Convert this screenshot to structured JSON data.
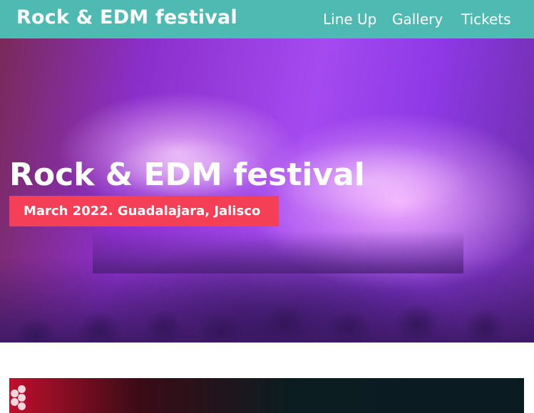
{
  "header": {
    "brand": "Rock & EDM festival",
    "nav": [
      {
        "label": "Line Up"
      },
      {
        "label": "Gallery"
      },
      {
        "label": "Tickets"
      }
    ]
  },
  "hero": {
    "title": "Rock & EDM festival",
    "subtitle": "March 2022. Guadalajara, Jalisco"
  },
  "colors": {
    "header_bg": "#4fbab2",
    "badge_bg": "#f43f57"
  }
}
